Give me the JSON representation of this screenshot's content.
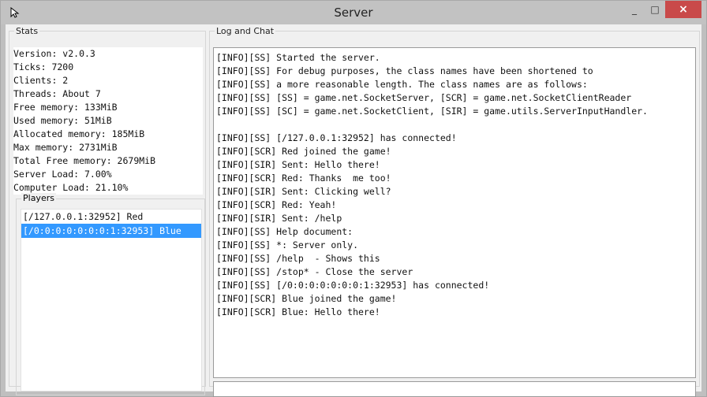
{
  "window": {
    "title": "Server",
    "minimize": "_",
    "maximize": "□",
    "close": "×"
  },
  "stats": {
    "legend": "Stats",
    "lines": [
      "Version: v2.0.3",
      "Ticks: 7200",
      "Clients: 2",
      "Threads: About 7",
      "Free memory: 133MiB",
      "Used memory: 51MiB",
      "Allocated memory: 185MiB",
      "Max memory: 2731MiB",
      "Total Free memory: 2679MiB",
      "Server Load: 7.00%",
      "Computer Load: 21.10%"
    ]
  },
  "players": {
    "legend": "Players",
    "items": [
      "[/127.0.0.1:32952] Red",
      "[/0:0:0:0:0:0:0:1:32953] Blue"
    ],
    "selected_index": 1
  },
  "log": {
    "legend": "Log and Chat",
    "lines": [
      "[INFO][SS] Started the server.",
      "[INFO][SS] For debug purposes, the class names have been shortened to",
      "[INFO][SS] a more reasonable length. The class names are as follows:",
      "[INFO][SS] [SS] = game.net.SocketServer, [SCR] = game.net.SocketClientReader",
      "[INFO][SS] [SC] = game.net.SocketClient, [SIR] = game.utils.ServerInputHandler.",
      "",
      "[INFO][SS] [/127.0.0.1:32952] has connected!",
      "[INFO][SCR] Red joined the game!",
      "[INFO][SIR] Sent: Hello there!",
      "[INFO][SCR] Red: Thanks  me too!",
      "[INFO][SIR] Sent: Clicking well?",
      "[INFO][SCR] Red: Yeah!",
      "[INFO][SIR] Sent: /help",
      "[INFO][SS] Help document:",
      "[INFO][SS] *: Server only.",
      "[INFO][SS] /help  - Shows this",
      "[INFO][SS] /stop* - Close the server",
      "[INFO][SS] [/0:0:0:0:0:0:0:1:32953] has connected!",
      "[INFO][SCR] Blue joined the game!",
      "[INFO][SCR] Blue: Hello there!"
    ],
    "input_value": ""
  }
}
